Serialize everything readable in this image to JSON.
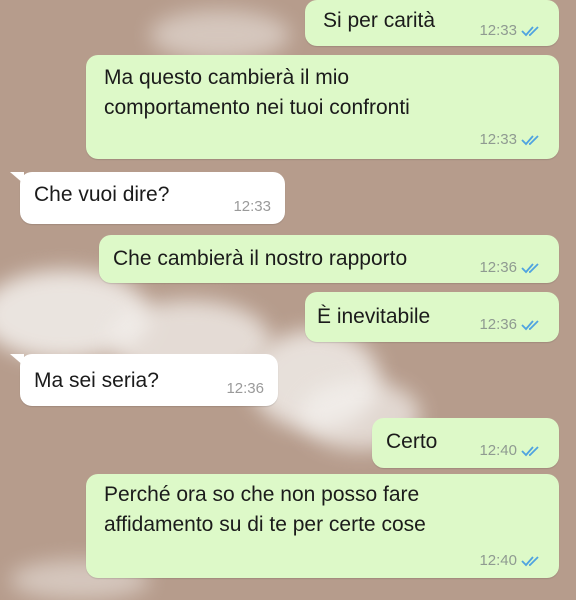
{
  "messages": [
    {
      "dir": "out",
      "text": "Si per carità",
      "time": "12:33",
      "status": "read"
    },
    {
      "dir": "out",
      "text": "Ma questo cambierà il mio\ncomportamento nei tuoi confronti",
      "time": "12:33",
      "status": "read"
    },
    {
      "dir": "in",
      "text": "Che vuoi dire?",
      "time": "12:33"
    },
    {
      "dir": "out",
      "text": "Che cambierà il nostro rapporto",
      "time": "12:36",
      "status": "read"
    },
    {
      "dir": "out",
      "text": "È inevitabile",
      "time": "12:36",
      "status": "read"
    },
    {
      "dir": "in",
      "text": "Ma sei seria?",
      "time": "12:36"
    },
    {
      "dir": "out",
      "text": "Certo",
      "time": "12:40",
      "status": "read"
    },
    {
      "dir": "out",
      "text": "Perché ora so che non posso fare\naffidamento su di te per certe cose",
      "time": "12:40",
      "status": "read"
    }
  ],
  "colors": {
    "outgoing_bubble": "#ddf9c8",
    "incoming_bubble": "#ffffff",
    "read_ticks": "#4fa3e0",
    "wallpaper": "#b69c8c"
  },
  "icons": {
    "read_receipt": "double-check-icon"
  }
}
